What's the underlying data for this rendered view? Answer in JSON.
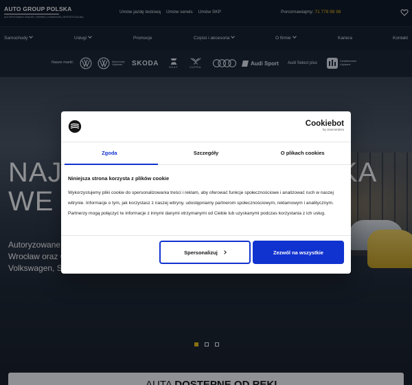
{
  "logo": {
    "title": "AUTO GROUP POLSKA",
    "subtitle": "AUTORYZOWANY DEALER   |   SERWIS   |   KOMISSION   |   WYPOŻYCZALNIA"
  },
  "topbar": {
    "links": [
      "Umów jazdę testową",
      "Umów serwis",
      "Umów SKP"
    ],
    "phone_label": "Porozmawiajmy:",
    "phone_number": "71 778 98 98"
  },
  "nav": {
    "items": [
      {
        "label": "Samochody",
        "dropdown": true
      },
      {
        "label": "Usługi",
        "dropdown": true
      },
      {
        "label": "Promocje",
        "dropdown": false
      },
      {
        "label": "Części i akcesoria",
        "dropdown": true
      },
      {
        "label": "O firmie",
        "dropdown": true
      },
      {
        "label": "Kariera",
        "dropdown": false
      },
      {
        "label": "Kontakt",
        "dropdown": false
      }
    ]
  },
  "brands": {
    "label": "Nasze marki:",
    "items": [
      {
        "name": "Volkswagen",
        "icon": "vw-logo-icon"
      },
      {
        "name": "Samochody Użytkowe",
        "icon": "vw-commercial-logo-icon"
      },
      {
        "name": "SKODA",
        "icon": "skoda-wordmark"
      },
      {
        "name": "SEAT",
        "icon": "seat-logo-icon"
      },
      {
        "name": "CUPRA",
        "icon": "cupra-logo-icon"
      },
      {
        "name": "Audi",
        "icon": "audi-rings-icon"
      },
      {
        "name": "Audi Sport",
        "icon": "audi-sport-logo-icon"
      },
      {
        "name": "Audi Select plus",
        "icon": "audi-select-plus-icon"
      },
      {
        "name": "Certyfikowane Używane",
        "icon": "certified-used-icon"
      }
    ]
  },
  "hero": {
    "heading_left_1": "NAJW",
    "heading_right_1": "KA",
    "heading_left_2": "WE W",
    "sub_line_1": "Autoryzowane s",
    "sub_line_2": "Wrocław oraz C",
    "sub_line_3": "Volkswagen, Sk",
    "slides_total": 3,
    "slide_active": 1
  },
  "ticker": {
    "regular": "AUTA ",
    "bold": "DOSTĘPNE OD RĘKI"
  },
  "cookie": {
    "brand_name": "Cookiebot",
    "brand_by": "by Usercentrics",
    "tabs": [
      {
        "label": "Zgoda",
        "active": true
      },
      {
        "label": "Szczegóły",
        "active": false
      },
      {
        "label": "O plikach cookies",
        "active": false
      }
    ],
    "title": "Niniejsza strona korzysta z plików cookie",
    "body": "Wykorzystujemy pliki cookie do spersonalizowania treści i reklam, aby oferować funkcje społecznościowe i analizować ruch w naszej witrynie. Informacje o tym, jak korzystasz z naszej witryny, udostępniamy partnerom społecznościowym, reklamowym i analitycznym. Partnerzy mogą połączyć te informacje z innymi danymi otrzymanymi od Ciebie lub uzyskanymi podczas korzystania z ich usług.",
    "btn_personalize": "Spersonalizuj",
    "btn_allow_all": "Zezwól na wszystkie"
  },
  "colors": {
    "accent_yellow": "#f1c40f",
    "cookie_blue": "#1032cf",
    "dark_bg": "#0c1520"
  }
}
